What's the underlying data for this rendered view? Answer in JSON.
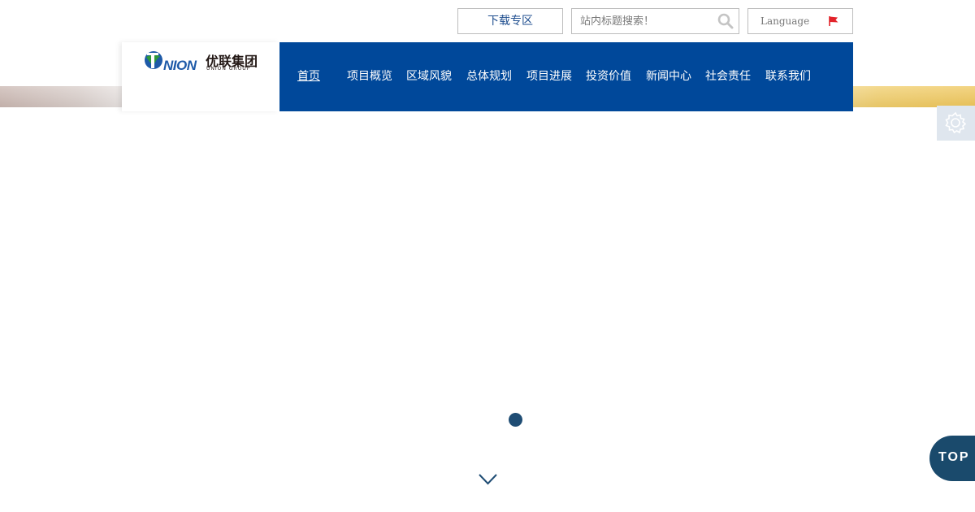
{
  "header": {
    "download_label": "下载专区",
    "search": {
      "placeholder": "站内标题搜索！",
      "value": ""
    },
    "language": {
      "label": "Language",
      "flag_color": "#e2232a"
    }
  },
  "logo": {
    "wordmark": "NION",
    "name_cn": "优联集团",
    "name_en": "UNION GROUP"
  },
  "nav": {
    "items": [
      {
        "label": "首页",
        "active": true
      },
      {
        "label": "项目概览"
      },
      {
        "label": "区域风貌"
      },
      {
        "label": "总体规划"
      },
      {
        "label": "项目进展"
      },
      {
        "label": "投资价值"
      },
      {
        "label": "新闻中心"
      },
      {
        "label": "社会责任"
      },
      {
        "label": "联系我们"
      }
    ]
  },
  "floating": {
    "top_label": "TOP"
  },
  "colors": {
    "nav_bg": "#00489a",
    "accent": "#1f4d74",
    "top_button": "#1a4a6c"
  },
  "icons": {
    "search": "search-icon",
    "flag": "flag-icon",
    "settings": "gear-icon",
    "scroll": "chevron-down-icon"
  }
}
